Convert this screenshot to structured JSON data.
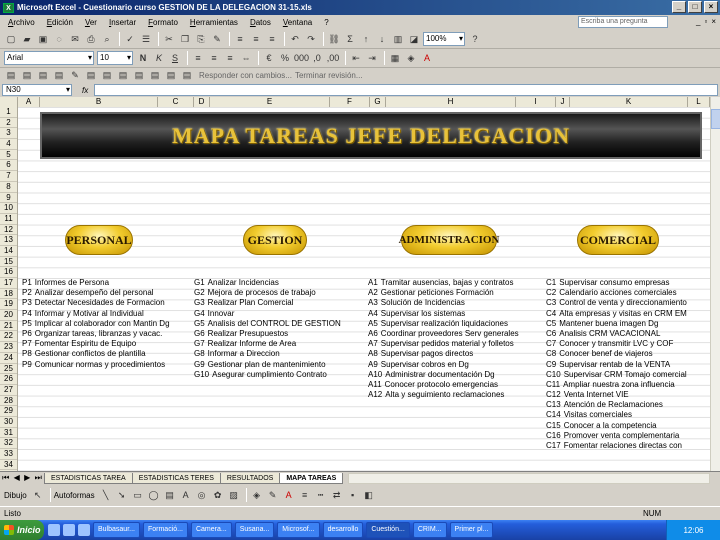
{
  "window": {
    "title": "Microsoft Excel - Cuestionario curso GESTION DE LA DELEGACION 31-15.xls",
    "app_icon": "X"
  },
  "menu": [
    "Archivo",
    "Edición",
    "Ver",
    "Insertar",
    "Formato",
    "Herramientas",
    "Datos",
    "Ventana",
    "?"
  ],
  "help_box": "Escriba una pregunta",
  "toolbar": {
    "zoom": "100%",
    "font": "Arial",
    "font_size": "10",
    "reply_text": "Responder con cambios...",
    "end_review": "Terminar revisión..."
  },
  "formula_bar": {
    "name_box": "N30",
    "fx": "fx"
  },
  "columns": [
    "A",
    "B",
    "C",
    "D",
    "E",
    "F",
    "G",
    "H",
    "I",
    "J",
    "K",
    "L"
  ],
  "rows": [
    "1",
    "2",
    "3",
    "4",
    "5",
    "6",
    "7",
    "8",
    "9",
    "10",
    "11",
    "12",
    "13",
    "14",
    "15",
    "16",
    "17",
    "18",
    "19",
    "20",
    "21",
    "22",
    "23",
    "24",
    "25",
    "26",
    "27",
    "28",
    "29",
    "30",
    "31",
    "32",
    "33",
    "34"
  ],
  "banner": {
    "title": "MAPA TAREAS JEFE DELEGACION"
  },
  "categories": [
    "PERSONAL",
    "GESTION",
    "ADMINISTRACION",
    "COMERCIAL"
  ],
  "personal": [
    {
      "code": "P1",
      "label": "Informes de Persona"
    },
    {
      "code": "P2",
      "label": "Analizar desempeño del personal"
    },
    {
      "code": "P3",
      "label": "Detectar Necesidades de Formacion"
    },
    {
      "code": "P4",
      "label": "Informar y Motivar al Individual"
    },
    {
      "code": "P5",
      "label": "Implicar al colaborador con Mantin Dg"
    },
    {
      "code": "P6",
      "label": "Organizar tareas, libranzas y vacac."
    },
    {
      "code": "P7",
      "label": "Fomentar Espiritu de Equipo"
    },
    {
      "code": "P8",
      "label": "Gestionar conflictos de plantilla"
    },
    {
      "code": "P9",
      "label": "Comunicar normas y procedimientos"
    }
  ],
  "gestion": [
    {
      "code": "G1",
      "label": "Analizar Incidencias"
    },
    {
      "code": "G2",
      "label": "Mejora de procesos de trabajo"
    },
    {
      "code": "G3",
      "label": "Realizar Plan Comercial"
    },
    {
      "code": "G4",
      "label": "Innovar"
    },
    {
      "code": "G5",
      "label": "Analisis del CONTROL DE GESTION"
    },
    {
      "code": "G6",
      "label": "Realizar Presupuestos"
    },
    {
      "code": "G7",
      "label": "Realizar Informe de Area"
    },
    {
      "code": "G8",
      "label": "Informar a Direccion"
    },
    {
      "code": "G9",
      "label": "Gestionar plan de mantenimiento"
    },
    {
      "code": "G10",
      "label": "Asegurar cumplimiento Contrato"
    }
  ],
  "administracion": [
    {
      "code": "A1",
      "label": "Tramitar ausencias, bajas y contratos"
    },
    {
      "code": "A2",
      "label": "Gestionar peticiones Formación"
    },
    {
      "code": "A3",
      "label": "Solución de Incidencias"
    },
    {
      "code": "A4",
      "label": "Supervisar los sistemas"
    },
    {
      "code": "A5",
      "label": "Supervisar realización liquidaciones"
    },
    {
      "code": "A6",
      "label": "Coordinar proveedores Serv generales"
    },
    {
      "code": "A7",
      "label": "Supervisar pedidos material y folletos"
    },
    {
      "code": "A8",
      "label": "Supervisar pagos directos"
    },
    {
      "code": "A9",
      "label": "Supervisar cobros en Dg"
    },
    {
      "code": "A10",
      "label": "Administrar documentación Dg"
    },
    {
      "code": "A11",
      "label": "Conocer protocolo emergencias"
    },
    {
      "code": "A12",
      "label": "Alta y seguimiento reclamaciones"
    }
  ],
  "comercial": [
    {
      "code": "C1",
      "label": "Supervisar consumo empresas"
    },
    {
      "code": "C2",
      "label": "Calendario acciones comerciales"
    },
    {
      "code": "C3",
      "label": "Control de venta y direccionamiento"
    },
    {
      "code": "C4",
      "label": "Alta empresas y visitas en CRM EM"
    },
    {
      "code": "C5",
      "label": "Mantener buena imagen Dg"
    },
    {
      "code": "C6",
      "label": "Analisis CRM VACACIONAL"
    },
    {
      "code": "C7",
      "label": "Conocer y transmitir LVC y COF"
    },
    {
      "code": "C8",
      "label": "Conocer benef de viajeros"
    },
    {
      "code": "C9",
      "label": "Supervisar rentab de la VENTA"
    },
    {
      "code": "C10",
      "label": "Supervisar CRM Tomajo comercial"
    },
    {
      "code": "C11",
      "label": "Ampliar nuestra zona influencia"
    },
    {
      "code": "C12",
      "label": "Venta Internet VIE"
    },
    {
      "code": "C13",
      "label": "Atención de Reclamaciones"
    },
    {
      "code": "C14",
      "label": "Visitas comerciales"
    },
    {
      "code": "C15",
      "label": "Conocer a la competencia"
    },
    {
      "code": "C16",
      "label": "Promover venta complementaria"
    },
    {
      "code": "C17",
      "label": "Fomentar relaciones directas con"
    }
  ],
  "sheet_tabs": [
    "ESTADISTICAS TAREA",
    "ESTADISTICAS TERES",
    "RESULTADOS",
    "MAPA TAREAS"
  ],
  "active_tab": "MAPA TAREAS",
  "drawbar": {
    "draw_label": "Dibujo",
    "autoshapes_label": "Autoformas"
  },
  "status": {
    "left": "Listo",
    "num": "NUM"
  },
  "taskbar": {
    "start": "Inicio",
    "buttons": [
      "Bulbasaur...",
      "Formació...",
      "Camera...",
      "Susana...",
      "Microsof...",
      "desarrollo",
      "Cuestión...",
      "CRIM...",
      "Primer pl..."
    ],
    "active_index": 6,
    "clock": "12:06"
  }
}
